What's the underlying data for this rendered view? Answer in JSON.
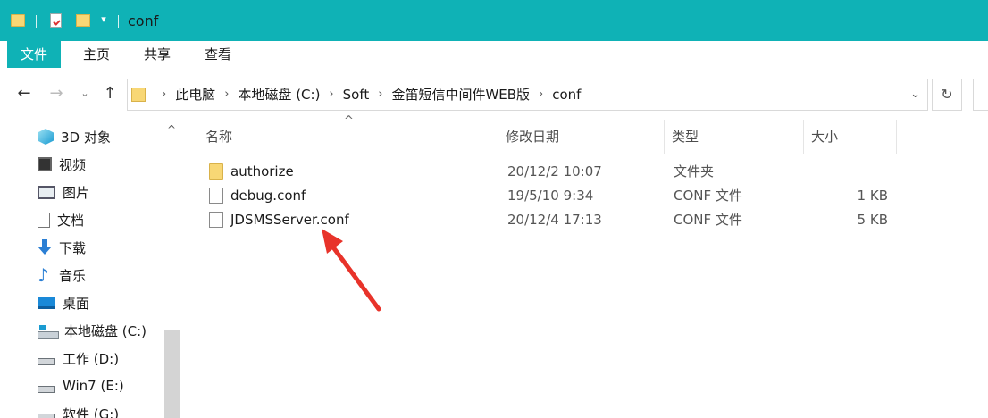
{
  "window": {
    "title": "conf"
  },
  "quick_access": {
    "dropdown_glyph": "▾"
  },
  "ribbon": {
    "tabs": [
      {
        "label": "文件"
      },
      {
        "label": "主页"
      },
      {
        "label": "共享"
      },
      {
        "label": "查看"
      }
    ]
  },
  "address": {
    "crumbs": [
      "此电脑",
      "本地磁盘 (C:)",
      "Soft",
      "金笛短信中间件WEB版",
      "conf"
    ],
    "separator": "›",
    "dropdown_glyph": "⌄",
    "refresh_glyph": "↻"
  },
  "nav_buttons": {
    "back": "←",
    "forward": "→",
    "recent": "⌄",
    "up": "↑"
  },
  "nav_pane": {
    "scroll_up_glyph": "^",
    "items": [
      {
        "label": "3D 对象",
        "icon": "3d-objects-icon"
      },
      {
        "label": "视频",
        "icon": "video-icon"
      },
      {
        "label": "图片",
        "icon": "pictures-icon"
      },
      {
        "label": "文档",
        "icon": "documents-icon"
      },
      {
        "label": "下载",
        "icon": "download-icon"
      },
      {
        "label": "音乐",
        "icon": "music-icon"
      },
      {
        "label": "桌面",
        "icon": "desktop-icon"
      },
      {
        "label": "本地磁盘 (C:)",
        "icon": "local-disk-icon"
      },
      {
        "label": "工作 (D:)",
        "icon": "drive-icon"
      },
      {
        "label": "Win7 (E:)",
        "icon": "drive-icon"
      },
      {
        "label": "软件 (G:)",
        "icon": "drive-icon"
      }
    ]
  },
  "columns": {
    "name": "名称",
    "date": "修改日期",
    "type": "类型",
    "size": "大小",
    "sort_glyph": "^"
  },
  "files": [
    {
      "name": "authorize",
      "date": "20/12/2 10:07",
      "type": "文件夹",
      "size": "",
      "icon": "folder-icon"
    },
    {
      "name": "debug.conf",
      "date": "19/5/10 9:34",
      "type": "CONF 文件",
      "size": "1 KB",
      "icon": "file-icon"
    },
    {
      "name": "JDSMSServer.conf",
      "date": "20/12/4 17:13",
      "type": "CONF 文件",
      "size": "5 KB",
      "icon": "file-icon"
    }
  ],
  "colors": {
    "titlebar": "#0fb2b6",
    "annotation_arrow": "#e8332a"
  }
}
